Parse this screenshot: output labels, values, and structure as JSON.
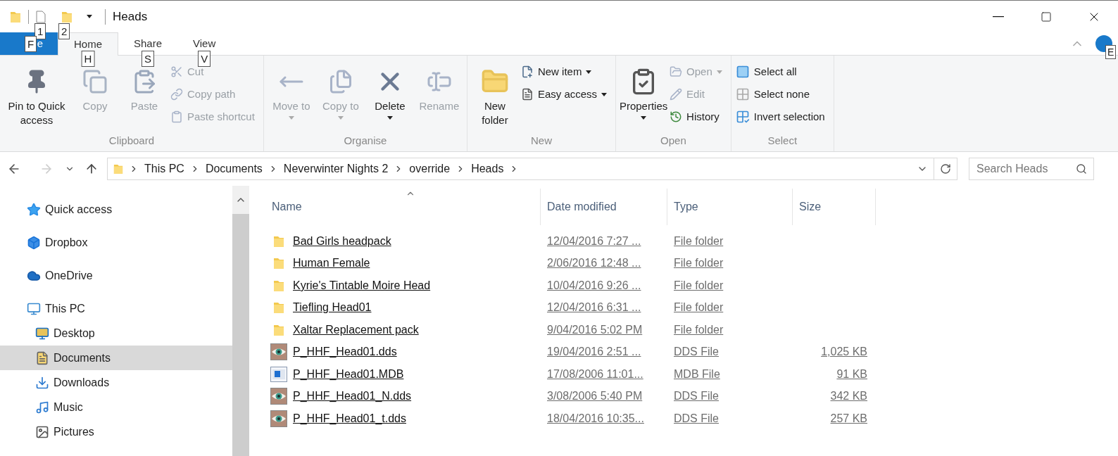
{
  "title_bar": {
    "keytips": [
      "1",
      "2"
    ],
    "title": "Heads"
  },
  "ribbon_tabs": [
    {
      "kind": "file",
      "label": "e",
      "keytip": "F",
      "selected": false
    },
    {
      "kind": "tab",
      "label": "Home",
      "keytip": "H",
      "selected": true
    },
    {
      "kind": "tab",
      "label": "Share",
      "keytip": "S",
      "selected": false
    },
    {
      "kind": "tab",
      "label": "View",
      "keytip": "V",
      "selected": false
    }
  ],
  "help_keytip": "E",
  "ribbon_groups": [
    {
      "label": "Clipboard",
      "large": [
        {
          "label": "Pin to Quick access",
          "disabled": false,
          "dropdown": false
        },
        {
          "label": "Copy",
          "disabled": true,
          "dropdown": false
        },
        {
          "label": "Paste",
          "disabled": true,
          "dropdown": false
        }
      ],
      "small": [
        {
          "label": "Cut",
          "disabled": true,
          "dropdown": false
        },
        {
          "label": "Copy path",
          "disabled": true,
          "dropdown": false
        },
        {
          "label": "Paste shortcut",
          "disabled": true,
          "dropdown": false
        }
      ]
    },
    {
      "label": "Organise",
      "large": [
        {
          "label": "Move to",
          "disabled": true,
          "dropdown": true
        },
        {
          "label": "Copy to",
          "disabled": true,
          "dropdown": true
        },
        {
          "label": "Delete",
          "disabled": false,
          "dropdown": true
        },
        {
          "label": "Rename",
          "disabled": true,
          "dropdown": false
        }
      ]
    },
    {
      "label": "New",
      "large": [
        {
          "label": "New folder",
          "disabled": false,
          "dropdown": false
        }
      ],
      "small": [
        {
          "label": "New item",
          "disabled": false,
          "dropdown": true
        },
        {
          "label": "Easy access",
          "disabled": false,
          "dropdown": true
        }
      ]
    },
    {
      "label": "Open",
      "large": [
        {
          "label": "Properties",
          "disabled": false,
          "dropdown": true
        }
      ],
      "small": [
        {
          "label": "Open",
          "disabled": true,
          "dropdown": true
        },
        {
          "label": "Edit",
          "disabled": true,
          "dropdown": false
        },
        {
          "label": "History",
          "disabled": false,
          "dropdown": false
        }
      ]
    },
    {
      "label": "Select",
      "small": [
        {
          "label": "Select all",
          "disabled": false,
          "dropdown": false
        },
        {
          "label": "Select none",
          "disabled": false,
          "dropdown": false
        },
        {
          "label": "Invert selection",
          "disabled": false,
          "dropdown": false
        }
      ]
    }
  ],
  "address_bar": {
    "breadcrumbs": [
      "This PC",
      "Documents",
      "Neverwinter Nights 2",
      "override",
      "Heads"
    ],
    "search": {
      "placeholder": "Search Heads"
    }
  },
  "navigation": [
    {
      "kind": "star",
      "label": "Quick access",
      "selected": false
    },
    {
      "kind": "dropbox",
      "label": "Dropbox",
      "selected": false
    },
    {
      "kind": "cloud",
      "label": "OneDrive",
      "selected": false
    },
    {
      "kind": "computer",
      "label": "This PC",
      "selected": false,
      "children": [
        {
          "kind": "desktop",
          "label": "Desktop",
          "selected": false
        },
        {
          "kind": "documents",
          "label": "Documents",
          "selected": true
        },
        {
          "kind": "downloads",
          "label": "Downloads",
          "selected": false
        },
        {
          "kind": "music",
          "label": "Music",
          "selected": false
        },
        {
          "kind": "pictures",
          "label": "Pictures",
          "selected": false
        }
      ]
    }
  ],
  "file_list": {
    "columns": [
      {
        "label": "Name",
        "sorted": true
      },
      {
        "label": "Date modified",
        "sorted": false
      },
      {
        "label": "Type",
        "sorted": false
      },
      {
        "label": "Size",
        "sorted": false
      }
    ],
    "rows": [
      {
        "kind": "folder",
        "name": "Bad Girls headpack",
        "date": "12/04/2016 7:27 ...",
        "type": "File folder"
      },
      {
        "kind": "folder",
        "name": "Human Female",
        "date": "2/06/2016 12:48 ...",
        "type": "File folder"
      },
      {
        "kind": "folder",
        "name": "Kyrie's Tintable Moire Head",
        "date": "10/04/2016 9:26 ...",
        "type": "File folder"
      },
      {
        "kind": "folder",
        "name": "Tiefling Head01",
        "date": "12/04/2016 6:31 ...",
        "type": "File folder"
      },
      {
        "kind": "folder",
        "name": "Xaltar Replacement pack",
        "date": "9/04/2016 5:02 PM",
        "type": "File folder"
      },
      {
        "kind": "image",
        "name": "P_HHF_Head01.dds",
        "date": "19/04/2016 2:51 ...",
        "type": "DDS File",
        "size": "1,025 KB"
      },
      {
        "kind": "model",
        "name": "P_HHF_Head01.MDB",
        "date": "17/08/2006 11:01...",
        "type": "MDB File",
        "size": "91 KB"
      },
      {
        "kind": "image",
        "name": "P_HHF_Head01_N.dds",
        "date": "3/08/2006 5:40 PM",
        "type": "DDS File",
        "size": "342 KB"
      },
      {
        "kind": "image",
        "name": "P_HHF_Head01_t.dds",
        "date": "18/04/2016 10:35...",
        "type": "DDS File",
        "size": "257 KB"
      }
    ]
  }
}
